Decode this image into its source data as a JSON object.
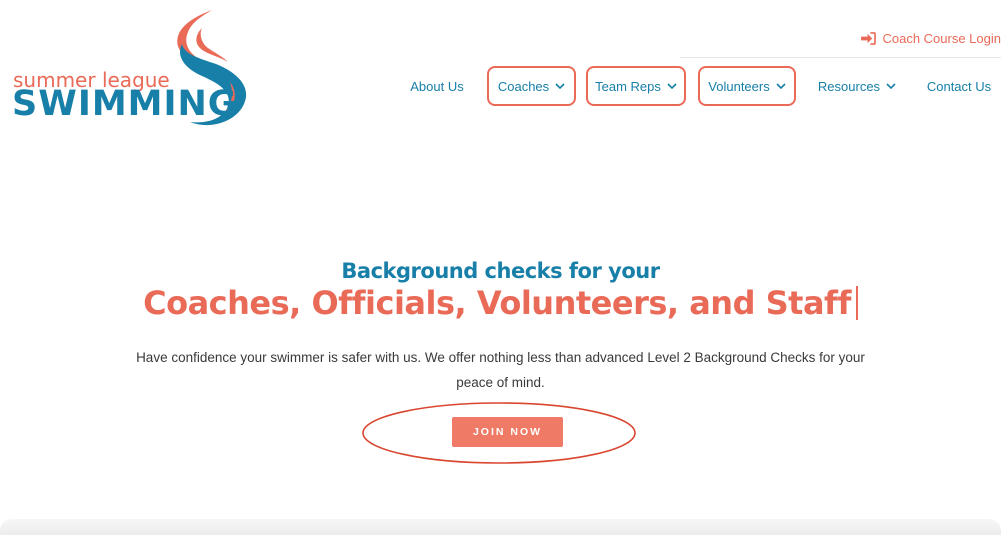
{
  "logo": {
    "line1": "summer league",
    "line2": "SWIMMING"
  },
  "top": {
    "login_label": "Coach Course Login",
    "login_icon": "sign-in-icon"
  },
  "nav": {
    "items": [
      {
        "label": "About Us",
        "dropdown": false,
        "boxed": false
      },
      {
        "label": "Coaches",
        "dropdown": true,
        "boxed": true
      },
      {
        "label": "Team Reps",
        "dropdown": true,
        "boxed": true
      },
      {
        "label": "Volunteers",
        "dropdown": true,
        "boxed": true
      },
      {
        "label": "Resources",
        "dropdown": true,
        "boxed": false
      },
      {
        "label": "Contact Us",
        "dropdown": false,
        "boxed": false
      }
    ]
  },
  "hero": {
    "subtitle": "Background checks for your",
    "title": "Coaches, Officials, Volunteers, and Staff",
    "description": "Have confidence your swimmer is safer with us. We offer nothing less than advanced Level 2 Background Checks for your peace of mind.",
    "cta_label": "JOIN NOW"
  },
  "colors": {
    "brand_blue": "#177fa8",
    "brand_coral": "#ea6a58",
    "cta_bg": "#ef7a66"
  }
}
